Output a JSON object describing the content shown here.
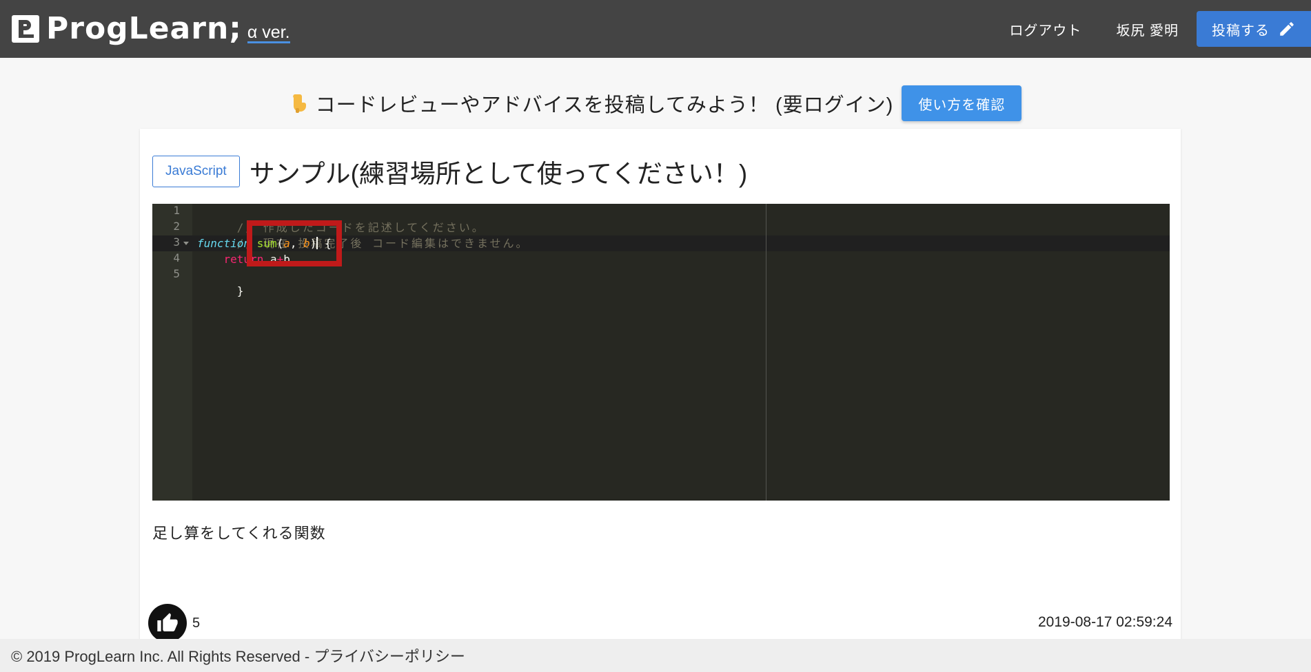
{
  "header": {
    "logo_text": "ProgLearn;",
    "logo_version": "α ver.",
    "nav": {
      "logout": "ログアウト",
      "user_name": "坂尻 愛明",
      "post_label": "投稿する"
    }
  },
  "promo": {
    "text": "コードレビューやアドバイスを投稿してみよう！ (要ログイン)",
    "howto_button": "使い方を確認"
  },
  "post": {
    "language": "JavaScript",
    "title": "サンプル(練習場所として使ってください！)",
    "description": "足し算をしてくれる関数",
    "like_count": "5",
    "timestamp": "2019-08-17 02:59:24",
    "code": {
      "line_numbers": [
        "1",
        "2",
        "3",
        "4",
        "5"
      ],
      "line1_comment": "// 作成したコードを記述してください。",
      "line2_comment": "// 現在 投稿完了後 コード編集はできません。",
      "line3_keyword": "function",
      "line3_fn": "sum",
      "line3_open": "(",
      "line3_param_a": "a",
      "line3_comma": ", ",
      "line3_param_b": "b",
      "line3_close": ")",
      "line3_brace": " {",
      "line4_indent": "    ",
      "line4_return": "return",
      "line4_space": " ",
      "line4_a": "a",
      "line4_op": "+",
      "line4_b": "b",
      "line5": "}"
    }
  },
  "footer": {
    "text": "© 2019 ProgLearn Inc. All Rights Reserved - プライバシーポリシー"
  },
  "colors": {
    "header_bg": "#444444",
    "accent": "#3a7bd5",
    "editor_bg": "#272822",
    "highlight": "#c01a1a"
  },
  "icons": [
    "pencil-icon",
    "pointing-hand-icon",
    "thumbs-up-icon"
  ]
}
